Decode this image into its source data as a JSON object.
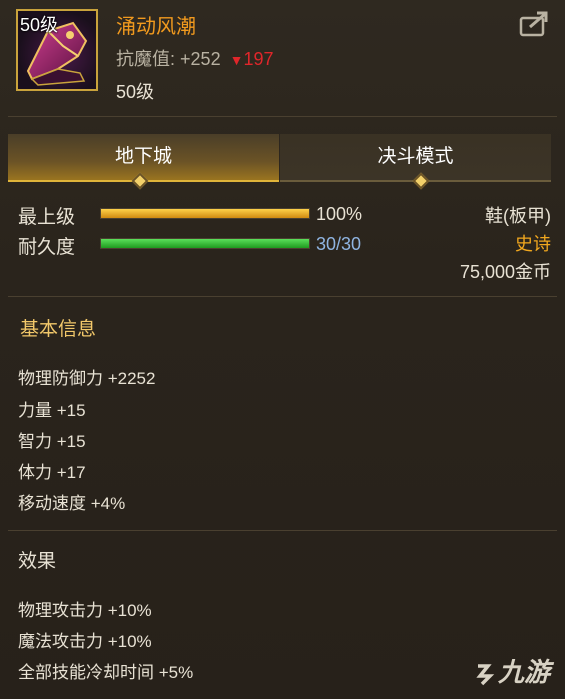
{
  "item": {
    "level_badge": "50级",
    "name": "涌动风潮",
    "resist_label": "抗魔值:",
    "resist_value": "+252",
    "resist_change": "197",
    "level_text": "50级"
  },
  "tabs": [
    {
      "label": "地下城",
      "active": true
    },
    {
      "label": "决斗模式",
      "active": false
    }
  ],
  "bars": {
    "upgrade_label": "最上级",
    "upgrade_value": "100%",
    "upgrade_fraction": 1.0,
    "durability_label": "耐久度",
    "durability_value": "30/30",
    "durability_fraction": 1.0
  },
  "info": {
    "type": "鞋(板甲)",
    "rarity": "史诗",
    "price": "75,000金币"
  },
  "basic": {
    "title": "基本信息",
    "attrs": [
      "物理防御力 +2252",
      "力量 +15",
      "智力 +15",
      "体力 +17",
      "移动速度 +4%"
    ]
  },
  "effects": {
    "title": "效果",
    "attrs": [
      "物理攻击力 +10%",
      "魔法攻击力 +10%",
      "全部技能冷却时间 +5%"
    ]
  },
  "watermark": "九游",
  "colors": {
    "name": "#f29a1e",
    "rarity": "#f2a81e",
    "decrease": "#e0262a",
    "upgrade_bar": "#f0b020",
    "durability_bar": "#2fbf2f",
    "durability_text": "#8fb4e0"
  },
  "icons": [
    "boot-item-icon",
    "share-icon",
    "watermark-logo-icon"
  ]
}
